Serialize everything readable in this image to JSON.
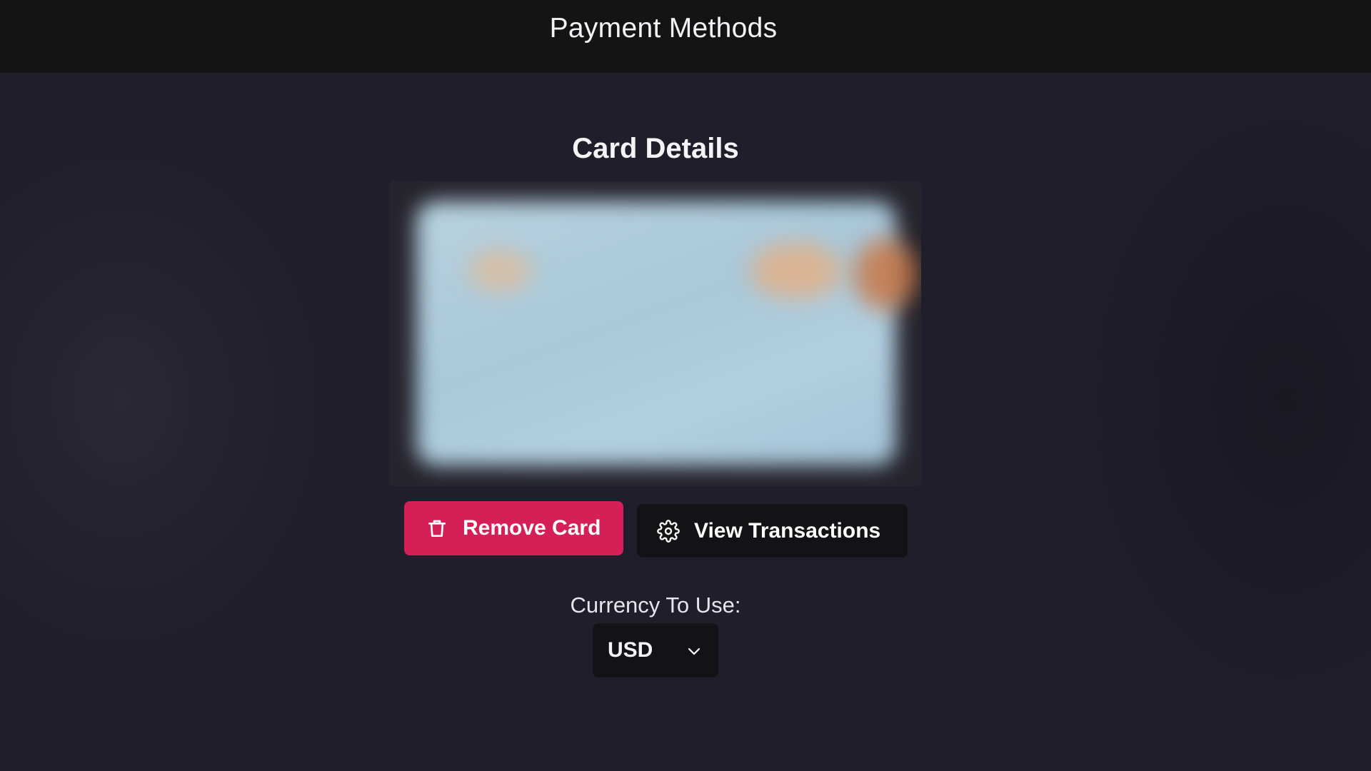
{
  "header": {
    "title": "Payment Methods"
  },
  "main": {
    "section_title": "Card Details",
    "card_image": {
      "description_icon": "blurred-card-image"
    },
    "actions": {
      "remove_label": "Remove Card",
      "remove_icon": "trash-icon",
      "view_label": "View Transactions",
      "view_icon": "gear-icon"
    },
    "currency": {
      "label": "Currency To Use:",
      "selected": "USD",
      "icon": "chevron-down-icon"
    }
  },
  "colors": {
    "background": "#201e2a",
    "header_bg": "#141415",
    "danger": "#d41f57",
    "dark_button": "#131214"
  }
}
